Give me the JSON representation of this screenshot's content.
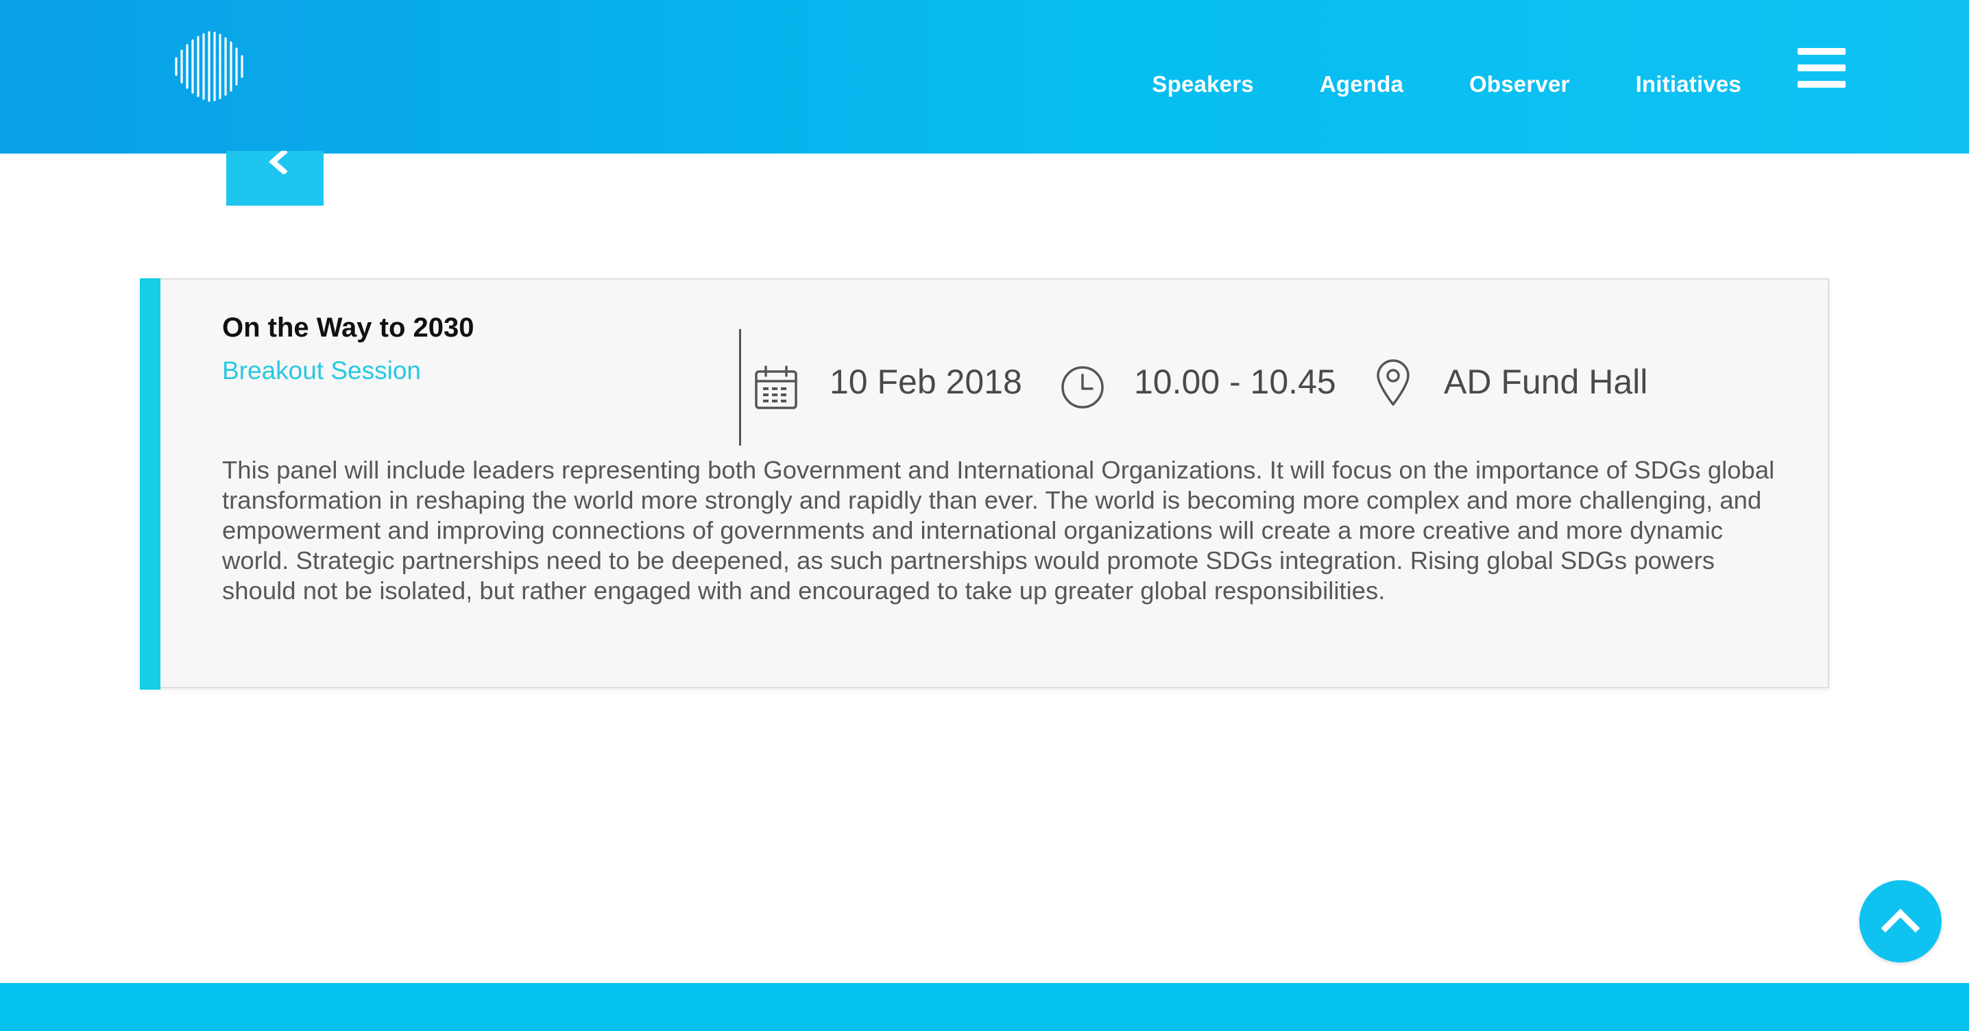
{
  "header": {
    "logo_icon": "soundwave-circle-logo",
    "nav": [
      "Speakers",
      "Agenda",
      "Observer",
      "Initiatives"
    ],
    "menu_icon": "hamburger-icon",
    "colors": {
      "header_start": "#0a9fe6",
      "header_end": "#10c2f4"
    }
  },
  "back_button": {
    "icon": "chevron-left-icon"
  },
  "session": {
    "title": "On the Way to 2030",
    "type": "Breakout Session",
    "date": "10 Feb 2018",
    "time": "10.00 - 10.45",
    "location": "AD Fund Hall",
    "description": "This panel will include leaders representing both Government and International Organizations. It will focus on the importance of SDGs global transformation in reshaping the world more strongly and rapidly than ever. The world is becoming more complex and more challenging, and empowerment and improving connections of governments and international organizations will create a more creative and more dynamic world. Strategic partnerships need to be deepened, as such partnerships would promote SDGs integration. Rising global SDGs powers should not be isolated, but rather engaged with and encouraged to take up greater global responsibilities.",
    "icons": {
      "date": "calendar-icon",
      "time": "clock-icon",
      "location": "map-pin-icon"
    },
    "accent_color": "#14cfe6",
    "type_color": "#27c8e3"
  },
  "scroll_top": {
    "icon": "chevron-up-icon",
    "color": "#0fc3f1"
  },
  "footer": {
    "color": "#05c1f0"
  }
}
